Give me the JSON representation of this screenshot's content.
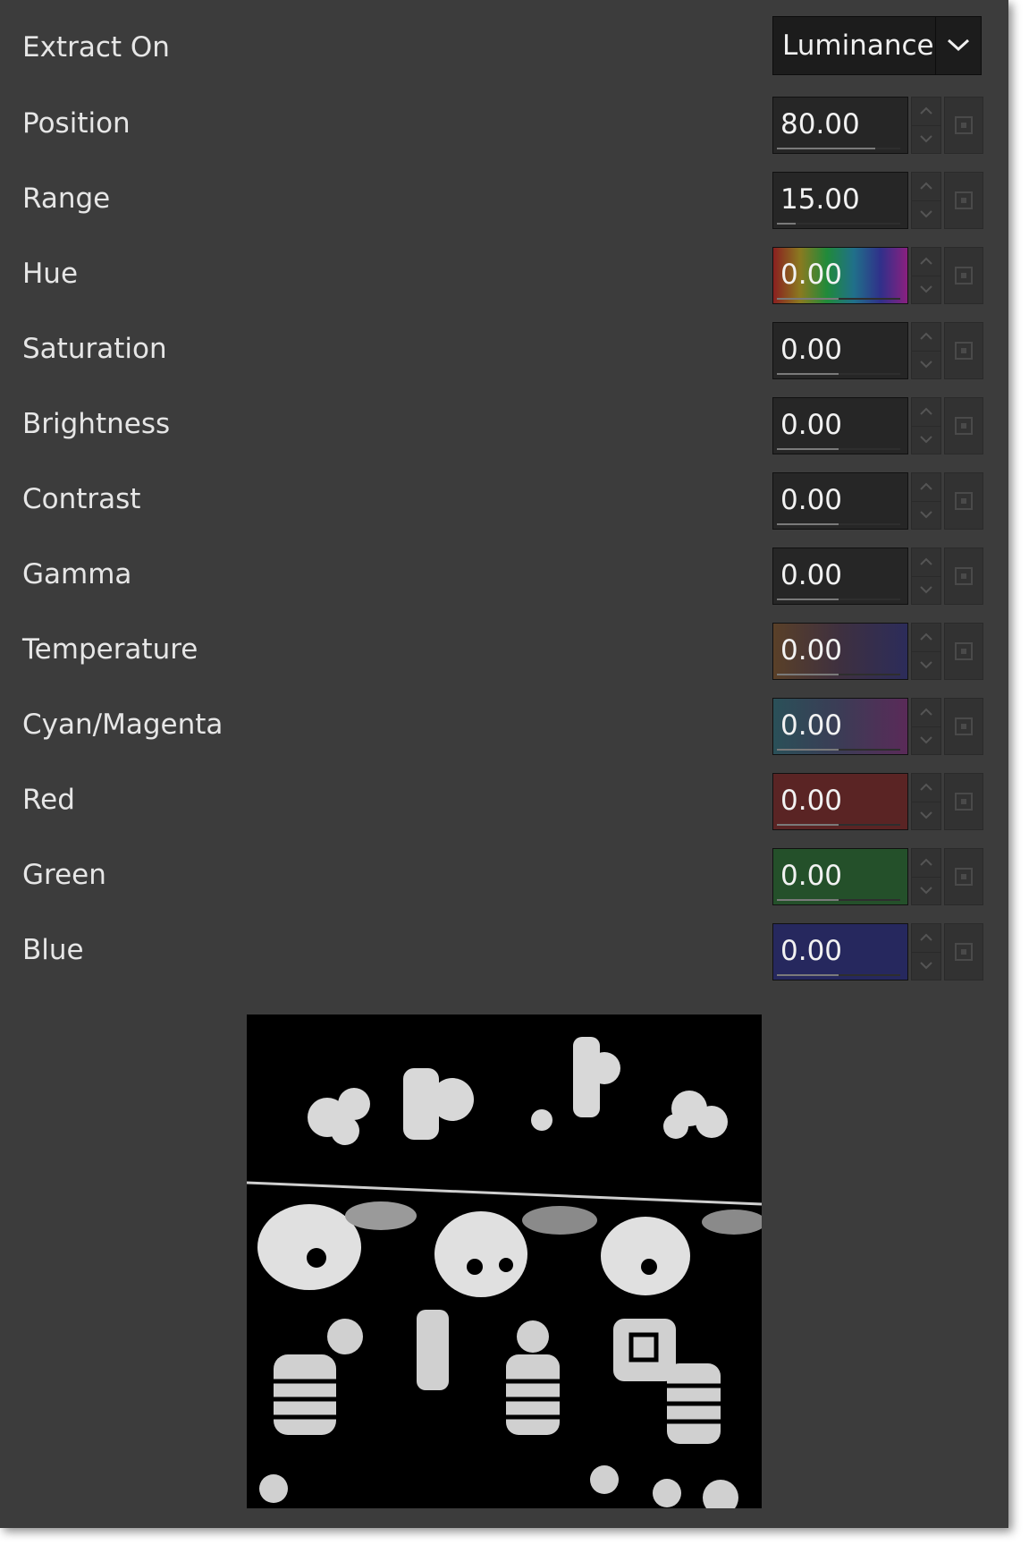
{
  "extract_on": {
    "label": "Extract On",
    "value": "Luminance"
  },
  "params": [
    {
      "label": "Position",
      "value": "80.00",
      "fill": 0.8,
      "bg": "#262626"
    },
    {
      "label": "Range",
      "value": "15.00",
      "fill": 0.15,
      "bg": "#262626"
    },
    {
      "label": "Hue",
      "value": "0.00",
      "fill": 0.5,
      "bg": "linear-gradient(to right,#8a2020,#8a7a20,#208a3a,#20708a,#30308a,#8a2080)"
    },
    {
      "label": "Saturation",
      "value": "0.00",
      "fill": 0.5,
      "bg": "#262626"
    },
    {
      "label": "Brightness",
      "value": "0.00",
      "fill": 0.5,
      "bg": "#262626"
    },
    {
      "label": "Contrast",
      "value": "0.00",
      "fill": 0.5,
      "bg": "#262626"
    },
    {
      "label": "Gamma",
      "value": "0.00",
      "fill": 0.5,
      "bg": "#262626"
    },
    {
      "label": "Temperature",
      "value": "0.00",
      "fill": 0.5,
      "bg": "linear-gradient(to right,#5a4028,#3e3040,#2c2c5a)"
    },
    {
      "label": "Cyan/Magenta",
      "value": "0.00",
      "fill": 0.5,
      "bg": "linear-gradient(to right,#2a5058,#3c3c56,#5a2a58)"
    },
    {
      "label": "Red",
      "value": "0.00",
      "fill": 0.5,
      "bg": "#5a2424"
    },
    {
      "label": "Green",
      "value": "0.00",
      "fill": 0.5,
      "bg": "#24502a"
    },
    {
      "label": "Blue",
      "value": "0.00",
      "fill": 0.5,
      "bg": "#26285e"
    }
  ],
  "icons": {
    "dropdown": "chevron-down-icon",
    "spin_up": "spin-up-icon",
    "spin_down": "spin-down-icon",
    "keyframe": "keyframe-icon"
  },
  "colors": {
    "panel_bg": "#3c3c3c",
    "field_bg": "#262626",
    "text": "#e6e6e6"
  }
}
